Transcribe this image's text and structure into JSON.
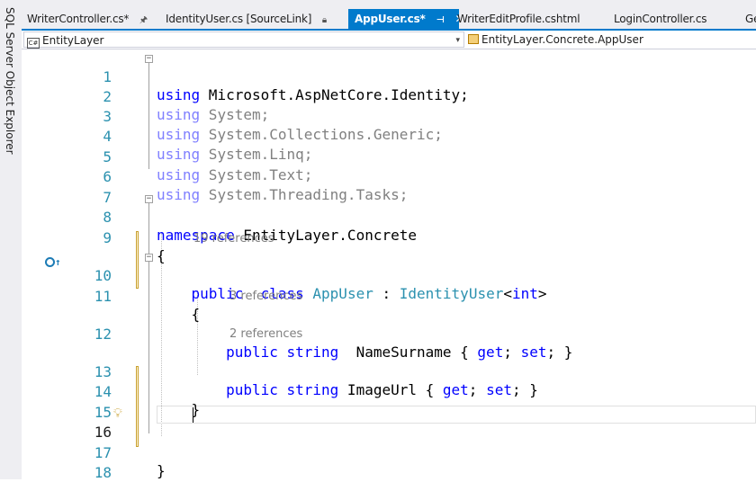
{
  "side_panel": {
    "label": "SQL Server Object Explorer"
  },
  "tabs": [
    {
      "label": "WriterController.cs*",
      "pinned": true,
      "active": false
    },
    {
      "label": "IdentityUser.cs [SourceLink]",
      "locked": true,
      "active": false
    },
    {
      "label": "AppUser.cs*",
      "active": true
    },
    {
      "label": "WriterEditProfile.cshtml",
      "active": false
    },
    {
      "label": "LoginController.cs",
      "active": false
    },
    {
      "label": "Ge",
      "active": false
    }
  ],
  "navigation": {
    "project": "EntityLayer",
    "type": "EntityLayer.Concrete.AppUser"
  },
  "editor": {
    "current_line": 16,
    "lines": [
      {
        "n": "1",
        "text": "using Microsoft.AspNetCore.Identity;"
      },
      {
        "n": "2",
        "text": "using System;"
      },
      {
        "n": "3",
        "text": "using System.Collections.Generic;"
      },
      {
        "n": "4",
        "text": "using System.Linq;"
      },
      {
        "n": "5",
        "text": "using System.Text;"
      },
      {
        "n": "6",
        "text": "using System.Threading.Tasks;"
      },
      {
        "n": "7",
        "text": ""
      },
      {
        "n": "8",
        "text": "namespace EntityLayer.Concrete"
      },
      {
        "n": "9",
        "text": "{"
      },
      {
        "n": "10",
        "text": "    public  class AppUser : IdentityUser<int>",
        "lens": "19 references"
      },
      {
        "n": "11",
        "text": "    {"
      },
      {
        "n": "12",
        "text": "        public string  NameSurname { get; set; }",
        "lens": "3 references"
      },
      {
        "n": "13",
        "text": "        public string ImageUrl { get; set; }",
        "lens": "2 references"
      },
      {
        "n": "14",
        "text": "    }"
      },
      {
        "n": "15",
        "text": ""
      },
      {
        "n": "16",
        "text": ""
      },
      {
        "n": "17",
        "text": "}"
      },
      {
        "n": "18",
        "text": ""
      }
    ]
  },
  "icons": {
    "implementation": "implementation-icon",
    "lightbulb": "lightbulb-icon"
  }
}
